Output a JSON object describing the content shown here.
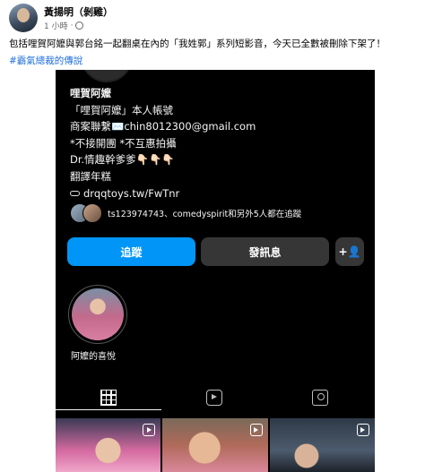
{
  "post": {
    "author": "黃揚明（剝雞）",
    "time": "1 小時",
    "text": "包括哩賀阿嬤與郭台銘一起翻桌在內的「我姓郭」系列短影音，今天已全數被刪除下架了！",
    "hashtag": "#霸氣總裁的傳說"
  },
  "instagram": {
    "bio": {
      "name": "哩賀阿嬤",
      "lines": [
        "「哩賀阿嬤」本人帳號",
        "商案聯繫✉️chin8012300@gmail.com",
        "*不接開團 *不互惠拍攝",
        "Dr.情趣幹爹爹👇🏻👇🏻👇🏻",
        "翻譯年糕"
      ],
      "link": "drqqtoys.tw/FwTnr"
    },
    "followers_text": "ts123974743、comedyspirit和另外5人都在追蹤",
    "buttons": {
      "follow": "追蹤",
      "message": "發訊息",
      "add_person": "+👤"
    },
    "highlight_label": "阿嬤的喜悅"
  }
}
